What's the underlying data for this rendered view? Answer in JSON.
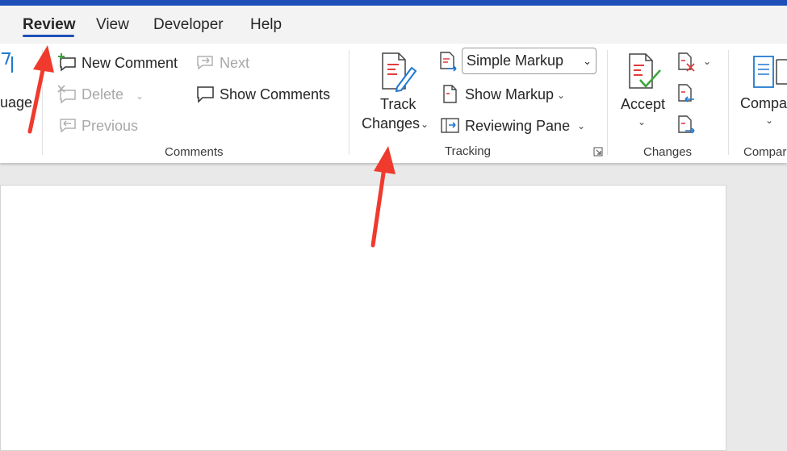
{
  "menubar": {
    "tabs": [
      {
        "label": "Review",
        "active": true
      },
      {
        "label": "View"
      },
      {
        "label": "Developer"
      },
      {
        "label": "Help"
      }
    ]
  },
  "ribbon": {
    "language": {
      "partial_label": "uage"
    },
    "comments": {
      "new_comment": "New Comment",
      "delete": "Delete",
      "previous": "Previous",
      "next": "Next",
      "show_comments": "Show Comments",
      "group_label": "Comments"
    },
    "tracking": {
      "track_line1": "Track",
      "track_line2": "Changes",
      "markup_select": "Simple Markup",
      "show_markup": "Show Markup",
      "reviewing_pane": "Reviewing Pane",
      "group_label": "Tracking"
    },
    "changes": {
      "accept": "Accept",
      "group_label": "Changes"
    },
    "compare": {
      "compare_partial": "Compa",
      "group_label_partial": "Compar"
    }
  },
  "colors": {
    "accent_blue": "#1e4fb8",
    "annotation_red": "#f03a2e",
    "check_green": "#3aa63a"
  }
}
